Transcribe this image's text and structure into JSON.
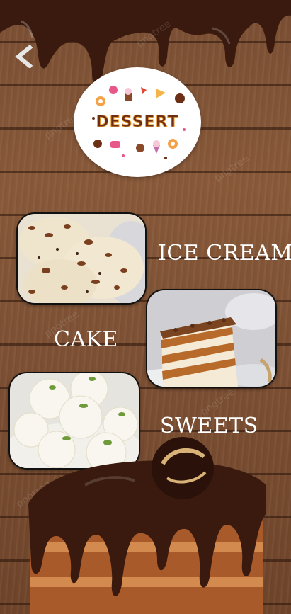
{
  "header": {
    "back_icon": "chevron-left-icon",
    "logo_text": "DESSERT"
  },
  "categories": [
    {
      "label": "ICE CREAM",
      "image": "ice-cream-photo"
    },
    {
      "label": "CAKE",
      "image": "layer-cake-photo"
    },
    {
      "label": "SWEETS",
      "image": "rasgulla-sweets-photo"
    }
  ],
  "watermark": "pngtree",
  "colors": {
    "chocolate": "#3a1a0e",
    "wood": "#7a4f33",
    "label": "#ffffff",
    "logo_text": "#6b2f16"
  }
}
